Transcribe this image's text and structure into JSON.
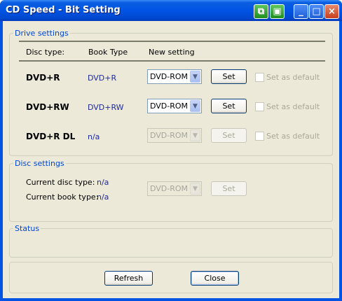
{
  "window": {
    "title": "CD Speed - Bit Setting"
  },
  "drive_settings": {
    "legend": "Drive settings",
    "headers": {
      "disc_type": "Disc type:",
      "book_type": "Book Type",
      "new_setting": "New setting"
    },
    "rows": [
      {
        "disc": "DVD+R",
        "book": "DVD+R",
        "select": "DVD-ROM",
        "set": "Set",
        "default": "Set as default"
      },
      {
        "disc": "DVD+RW",
        "book": "DVD+RW",
        "select": "DVD-ROM",
        "set": "Set",
        "default": "Set as default"
      },
      {
        "disc": "DVD+R DL",
        "book": "n/a",
        "select": "DVD-ROM",
        "set": "Set",
        "default": "Set as default"
      }
    ]
  },
  "disc_settings": {
    "legend": "Disc settings",
    "current_disc_label": "Current disc type:",
    "current_disc_value": "n/a",
    "current_book_label": "Current book type:",
    "current_book_value": "n/a",
    "select": "DVD-ROM",
    "set": "Set"
  },
  "status": {
    "legend": "Status"
  },
  "buttons": {
    "refresh": "Refresh",
    "close": "Close"
  }
}
